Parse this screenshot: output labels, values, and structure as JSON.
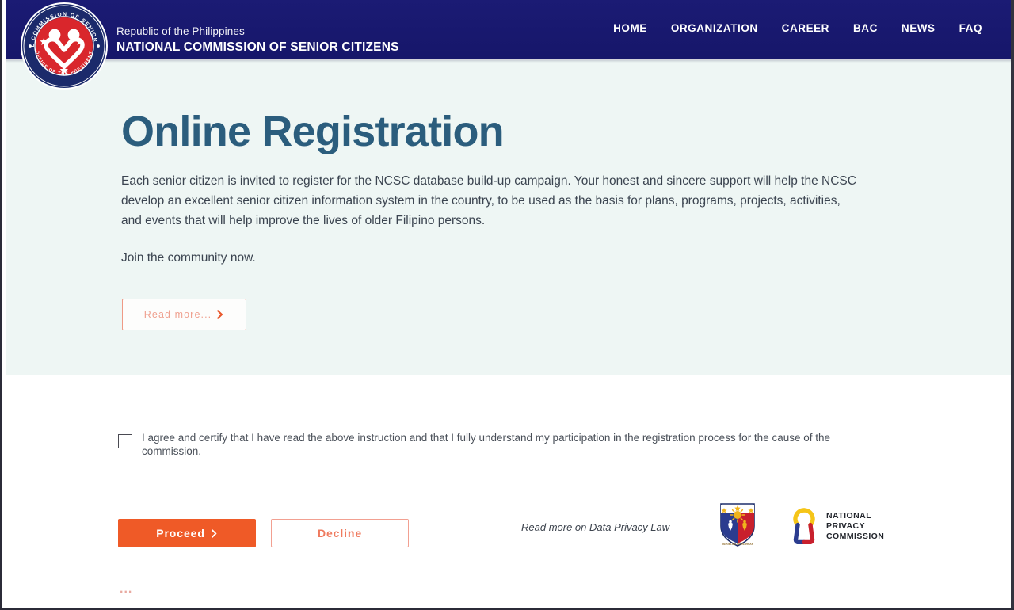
{
  "header": {
    "logo": {
      "icon": "ncsc-seal-logo",
      "ring_top_text": "NATIONAL COMMISSION OF SENIOR CITIZENS",
      "ring_bottom_text": "OFFICE OF THE PRESIDENT",
      "ring_color": "#1b2a6b",
      "disc_color": "#d9262c"
    },
    "brand_line1": "Republic of the Philippines",
    "brand_line2": "NATIONAL COMMISSION OF SENIOR CITIZENS",
    "background_color": "#191970",
    "nav": [
      {
        "label": "HOME"
      },
      {
        "label": "ORGANIZATION"
      },
      {
        "label": "CAREER"
      },
      {
        "label": "BAC"
      },
      {
        "label": "NEWS"
      },
      {
        "label": "FAQ"
      }
    ]
  },
  "hero": {
    "background_color": "#eef6f4",
    "title": "Online Registration",
    "title_color": "#2b5d7d",
    "paragraph": "Each senior citizen is invited to register for the NCSC database build-up campaign.  Your honest and sincere support will help the NCSC develop an excellent senior citizen information system in the country, to be used as the basis for plans, programs, projects, activities, and events that will help improve the lives of older Filipino persons.",
    "join_text": "Join the community now.",
    "read_more": {
      "label": "Read more...",
      "icon": "chevron-right-icon",
      "border_color": "#ef9a86",
      "text_color": "#efa190"
    }
  },
  "consent": {
    "checked": false,
    "text": "I agree and certify that I have read the above instruction and that I fully understand my participation in the registration process for the cause of the commission."
  },
  "actions": {
    "proceed": {
      "label": "Proceed",
      "icon": "chevron-right-icon",
      "background_color": "#ef5a27",
      "text_color": "#ffffff"
    },
    "decline": {
      "label": "Decline",
      "border_color": "#f2a091",
      "text_color": "#ef7a5e"
    },
    "privacy_link": "Read more on Data Privacy Law"
  },
  "footer_logos": {
    "coat_of_arms": {
      "icon": "philippine-coat-of-arms-logo",
      "motto": "REPUBLIKA NG PILIPINAS"
    },
    "npc": {
      "icon": "national-privacy-commission-logo",
      "words": "NATIONAL\nPRIVACY\nCOMMISSION",
      "gold": "#f5c518",
      "blue": "#2b3c8f",
      "red": "#c8202d"
    }
  },
  "footer": {
    "ellipsis": "..."
  }
}
